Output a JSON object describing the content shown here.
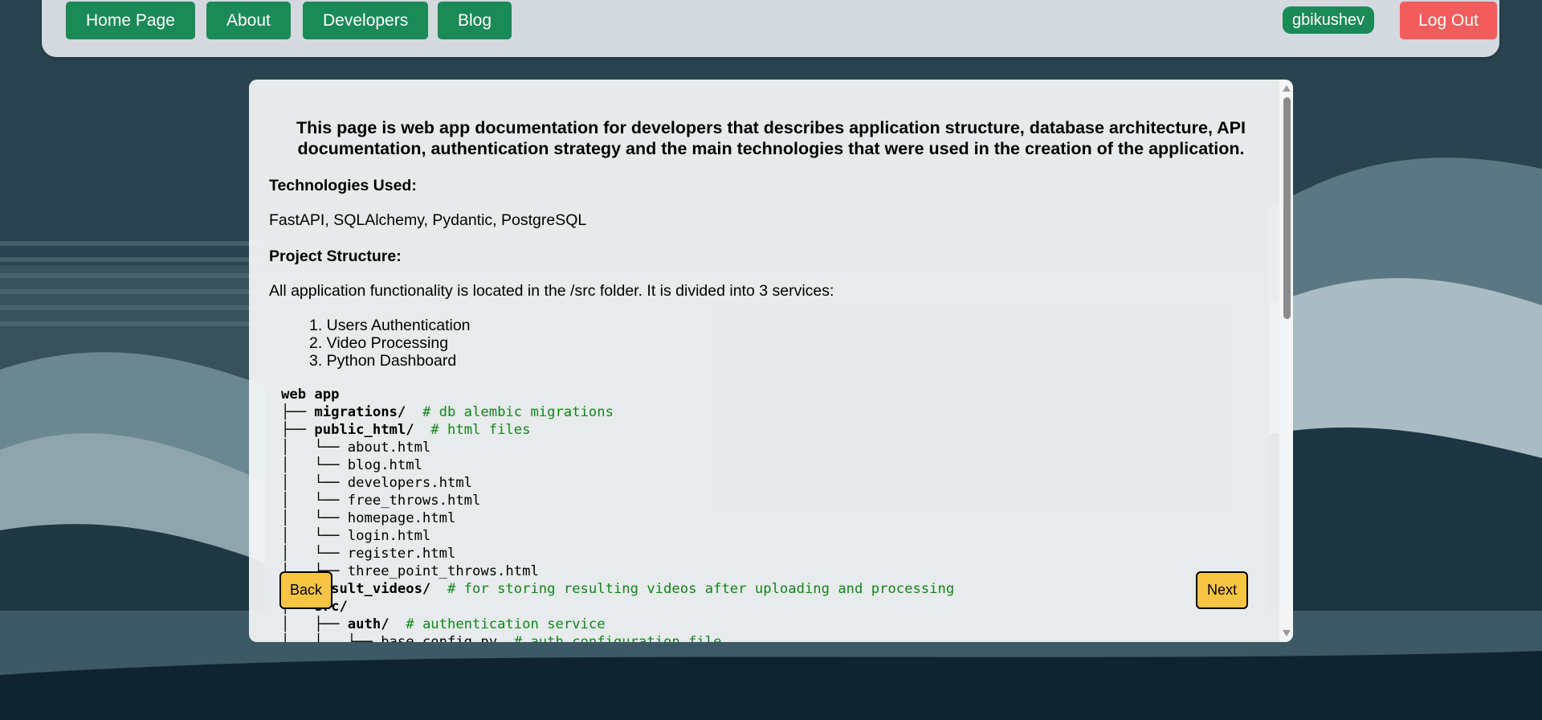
{
  "nav": {
    "links": [
      "Home Page",
      "About",
      "Developers",
      "Blog"
    ],
    "username": "gbikushev",
    "logout_label": "Log Out"
  },
  "doc": {
    "intro": "This page is web app documentation for developers that describes application structure, database architecture, API documentation, authentication strategy and the main technologies that were used in the creation of the application.",
    "tech_heading": "Technologies Used:",
    "tech_list": "FastAPI, SQLAlchemy, Pydantic, PostgreSQL",
    "structure_heading": "Project Structure:",
    "structure_text": "All application functionality is located in the /src folder. It is divided into 3 services:",
    "services": [
      "1. Users Authentication",
      "2. Video Processing",
      "3. Python Dashboard"
    ],
    "tree": {
      "root": "web app",
      "migrations": "migrations/",
      "migrations_comment": "# db alembic migrations",
      "public_html": "public_html/",
      "public_html_comment": "# html files",
      "files": [
        "about.html",
        "blog.html",
        "developers.html",
        "free_throws.html",
        "homepage.html",
        "login.html",
        "register.html",
        "three_point_throws.html"
      ],
      "result_videos": "result_videos/",
      "result_videos_comment": "# for storing resulting videos after uploading and processing",
      "src": "src/",
      "auth": "auth/",
      "auth_comment": "# authentication service",
      "base_config": "base_config.py",
      "base_config_comment": "# auth configuration file"
    }
  },
  "pager": {
    "back_label": "Back",
    "next_label": "Next"
  },
  "colors": {
    "nav_green": "#1a8a57",
    "logout_red": "#f25c5c",
    "pager_yellow": "#f7c444",
    "comment_green": "#12851a"
  }
}
